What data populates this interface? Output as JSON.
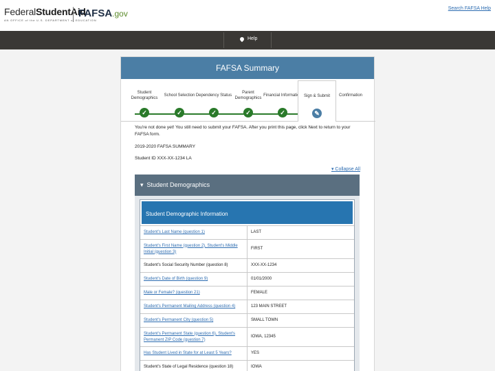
{
  "header": {
    "logo_fsa_light": "Federal",
    "logo_fsa_bold": "Student",
    "logo_fsa_end": "Aid",
    "logo_fsa_sub": "AN OFFICE of the U.S. DEPARTMENT of EDUCATION",
    "logo_fafsa": "FAFSA",
    "logo_fafsa_tld": ".gov",
    "help_link": "Search FAFSA Help"
  },
  "nav": {
    "help_label": "Help"
  },
  "card": {
    "title": "FAFSA Summary",
    "steps": [
      {
        "label": "Student Demographics"
      },
      {
        "label": "School Selection"
      },
      {
        "label": "Dependency Status"
      },
      {
        "label": "Parent Demographics"
      },
      {
        "label": "Financial Information"
      },
      {
        "label": "Sign & Submit"
      },
      {
        "label": "Confirmation"
      }
    ],
    "step_done_glyph": "✓",
    "step_active_glyph": "✎",
    "intro": "You're not done yet! You still need to submit your FAFSA. After you print this page, click Next to return to your FAFSA form.",
    "summary_title": "2019-2020 FAFSA SUMMARY",
    "student_id": "Student ID XXX-XX-1234 LA",
    "collapse_all": "Collapse All",
    "section_header": "Student Demographics",
    "table_title": "Student Demographic Information",
    "rows": [
      {
        "q": "Student's Last Name (question 1)",
        "v": "Last"
      },
      {
        "q": "Student's First Name (question 2), Student's Middle Initial (question 3)",
        "v": "First"
      },
      {
        "q": "Student's Social Security Number (question 8)",
        "v": "XXX-XX-1234"
      },
      {
        "q": "Student's Date of Birth (question 9)",
        "v": "01/01/2000"
      },
      {
        "q": "Male or Female? (question 21)",
        "v": "Female"
      },
      {
        "q": "Student's Permanent Mailing Address (question 4)",
        "v": "123 Main Street"
      },
      {
        "q": "Student's Permanent City (question 5)",
        "v": "Small Town"
      },
      {
        "q": "Student's Permanent State (question 6), Student's Permanent ZIP Code (question 7)",
        "v": "Iowa, 12345"
      },
      {
        "q": "Has Student Lived in State for at Least 5 Years?",
        "v": "Yes"
      },
      {
        "q": "Student's State of Legal Residence (question 18)",
        "v": "Iowa"
      }
    ]
  }
}
